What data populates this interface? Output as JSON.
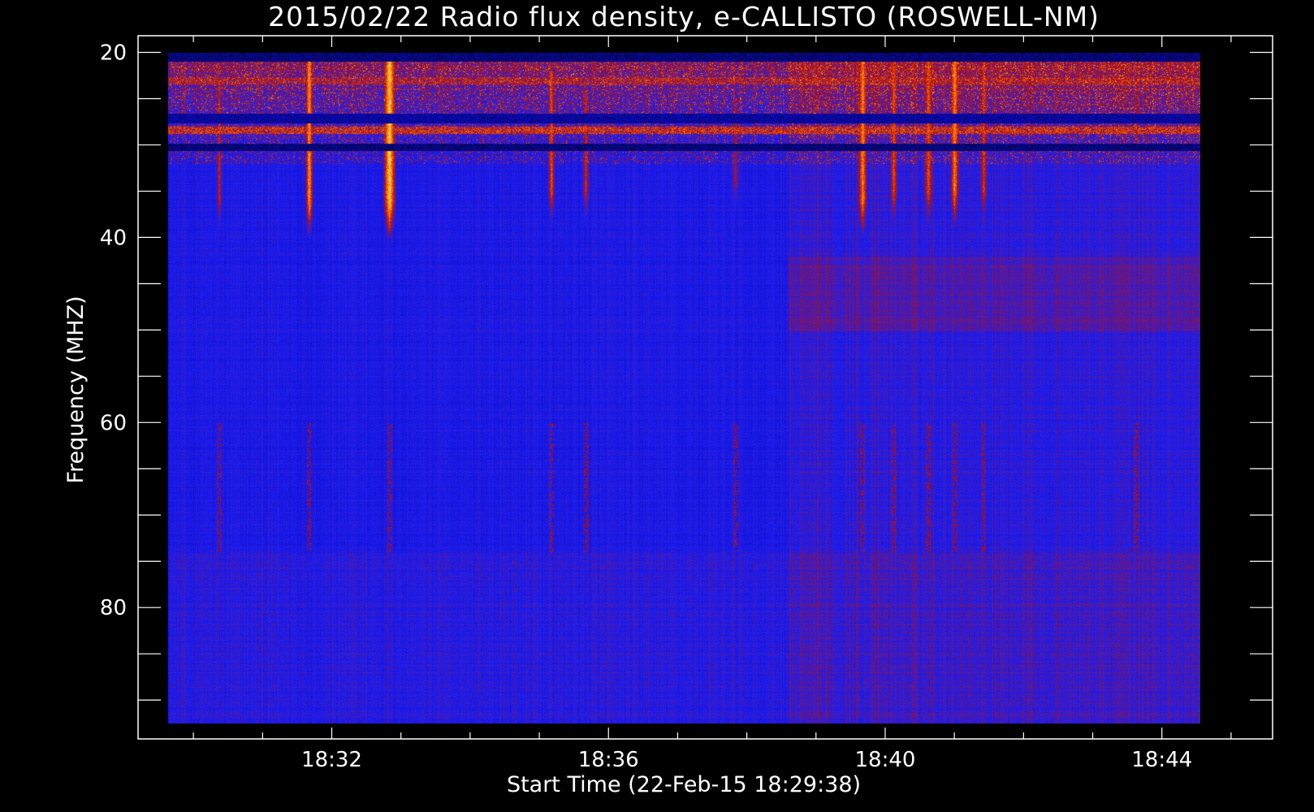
{
  "chart_data": {
    "type": "heatmap",
    "title": "2015/02/22  Radio flux density, e-CALLISTO (ROSWELL-NM)",
    "xlabel": "Start Time (22-Feb-15 18:29:38)",
    "ylabel": "Frequency (MHZ)",
    "x_axis": {
      "ticks": [
        "18:32",
        "18:36",
        "18:40",
        "18:44"
      ],
      "tick_minutes": [
        32,
        36,
        40,
        44
      ],
      "range_minutes": [
        29.2,
        45.6
      ],
      "data_start_minutes": 29.633,
      "data_end_minutes": 44.55
    },
    "y_axis": {
      "ticks": [
        "20",
        "40",
        "60",
        "80"
      ],
      "tick_values": [
        20,
        40,
        60,
        80
      ],
      "range": [
        18.2,
        94.2
      ],
      "inverted": true,
      "data_range": [
        20,
        92.5
      ]
    },
    "colormap": [
      "#000000",
      "#0b0bc8",
      "#1e1ef0",
      "#b41010",
      "#ff6a00",
      "#ffe640",
      "#ffffff"
    ],
    "background_level": 0.3,
    "bursts": [
      {
        "minute": 30.37,
        "f_start": 23,
        "f_end": 40,
        "intensity": 0.62
      },
      {
        "minute": 31.67,
        "f_start": 20,
        "f_end": 40,
        "intensity": 0.85
      },
      {
        "minute": 32.83,
        "f_start": 20,
        "f_end": 40,
        "intensity": 0.95
      },
      {
        "minute": 35.17,
        "f_start": 22,
        "f_end": 39,
        "intensity": 0.7
      },
      {
        "minute": 35.67,
        "f_start": 24,
        "f_end": 39,
        "intensity": 0.62
      },
      {
        "minute": 37.83,
        "f_start": 25,
        "f_end": 38,
        "intensity": 0.55
      },
      {
        "minute": 39.67,
        "f_start": 20,
        "f_end": 40,
        "intensity": 0.8
      },
      {
        "minute": 40.12,
        "f_start": 20,
        "f_end": 39,
        "intensity": 0.7
      },
      {
        "minute": 40.62,
        "f_start": 20,
        "f_end": 39,
        "intensity": 0.7
      },
      {
        "minute": 41.0,
        "f_start": 20,
        "f_end": 39,
        "intensity": 0.8
      },
      {
        "minute": 41.42,
        "f_start": 20,
        "f_end": 39,
        "intensity": 0.65
      },
      {
        "minute": 43.62,
        "f_start": 20,
        "f_end": 33,
        "intensity": 0.55
      }
    ],
    "bands": [
      {
        "f_start": 20,
        "f_end": 21,
        "intensity": 0.05
      },
      {
        "f_start": 22.6,
        "f_end": 23.4,
        "intensity": 0.55
      },
      {
        "f_start": 26.6,
        "f_end": 27.6,
        "intensity": 0.08
      },
      {
        "f_start": 28.0,
        "f_end": 28.8,
        "intensity": 0.62
      },
      {
        "f_start": 29.8,
        "f_end": 30.6,
        "intensity": 0.05
      }
    ]
  }
}
